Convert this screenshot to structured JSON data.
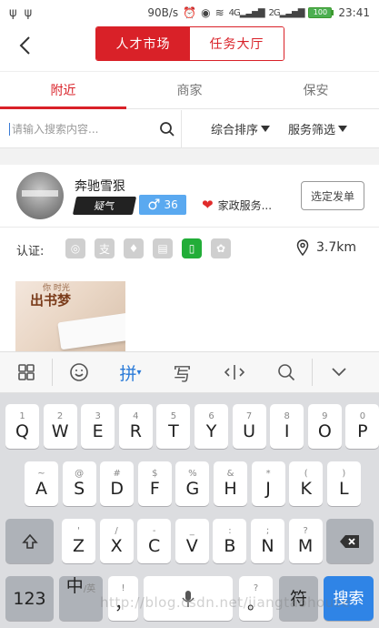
{
  "status_bar": {
    "left_icons": [
      "usb-icon",
      "usb-icon"
    ],
    "speed": "90B/s",
    "network_badges": [
      "4G",
      "2G"
    ],
    "battery": "100",
    "time": "23:41"
  },
  "nav": {
    "segments": [
      {
        "label": "人才市场",
        "active": true
      },
      {
        "label": "任务大厅",
        "active": false
      }
    ]
  },
  "tabs": [
    {
      "label": "附近",
      "active": true
    },
    {
      "label": "商家",
      "active": false
    },
    {
      "label": "保安",
      "active": false
    }
  ],
  "filter": {
    "search_placeholder": "请输入搜索内容...",
    "sort_label": "综合排序",
    "filter_label": "服务筛选"
  },
  "card": {
    "name": "奔驰雪狠",
    "tag": "疑气",
    "gender_age": "36",
    "service": "家政服务...",
    "order_button": "选定发单",
    "cert_label": "认证:",
    "distance": "3.7km",
    "photo_title": "出书梦",
    "photo_side_text": "你  时光"
  },
  "keyboard": {
    "toolbar": [
      "grid-icon",
      "emoji-icon",
      "拼",
      "写",
      "cursor-icon",
      "search-icon",
      "collapse-icon"
    ],
    "rows": [
      [
        [
          "1",
          "Q"
        ],
        [
          "2",
          "W"
        ],
        [
          "3",
          "E"
        ],
        [
          "4",
          "R"
        ],
        [
          "5",
          "T"
        ],
        [
          "6",
          "Y"
        ],
        [
          "7",
          "U"
        ],
        [
          "8",
          "I"
        ],
        [
          "9",
          "O"
        ],
        [
          "0",
          "P"
        ]
      ],
      [
        [
          "~",
          "A"
        ],
        [
          "@",
          "S"
        ],
        [
          "#",
          "D"
        ],
        [
          "$",
          "F"
        ],
        [
          "%",
          "G"
        ],
        [
          "&",
          "H"
        ],
        [
          "*",
          "J"
        ],
        [
          "(",
          "K"
        ],
        [
          ")",
          "L"
        ]
      ],
      [
        [
          "'",
          "Z"
        ],
        [
          "/",
          "X"
        ],
        [
          "-",
          "C"
        ],
        [
          "_",
          "V"
        ],
        [
          ":",
          "B"
        ],
        [
          ";",
          "N"
        ],
        [
          "?",
          "M"
        ]
      ]
    ],
    "key_123": "123",
    "key_lang": "中",
    "key_lang_sub": "/英",
    "key_comma_hint": "!",
    "key_comma": "，",
    "key_period_hint": "?",
    "key_period": "。",
    "key_symbol": "符",
    "key_search": "搜索"
  },
  "watermark": "http://blog.csdn.net/jiangtaohouse"
}
